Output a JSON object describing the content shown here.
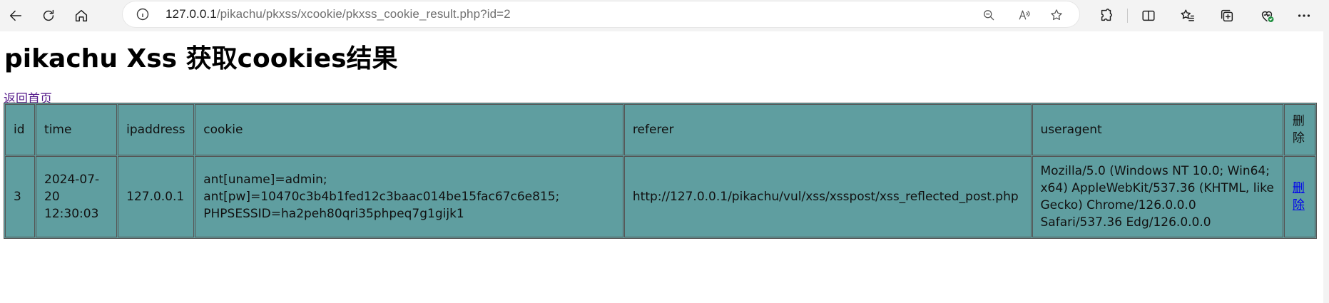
{
  "browser": {
    "url_prefix": "127.0.0.1",
    "url_path": "/pikachu/pkxss/xcookie/pkxss_cookie_result.php?id=2"
  },
  "page": {
    "title": "pikachu Xss 获取cookies结果",
    "back_link": "返回首页"
  },
  "table": {
    "headers": [
      "id",
      "time",
      "ipaddress",
      "cookie",
      "referer",
      "useragent",
      "删除"
    ],
    "rows": [
      {
        "id": "3",
        "time": "2024-07-20 12:30:03",
        "ipaddress": "127.0.0.1",
        "cookie": "ant[uname]=admin; ant[pw]=10470c3b4b1fed12c3baac014be15fac67c6e815; PHPSESSID=ha2peh80qri35phpeq7g1gijk1",
        "referer": "http://127.0.0.1/pikachu/vul/xss/xsspost/xss_reflected_post.php",
        "useragent": "Mozilla/5.0 (Windows NT 10.0; Win64; x64) AppleWebKit/537.36 (KHTML, like Gecko) Chrome/126.0.0.0 Safari/537.36 Edg/126.0.0.0",
        "delete": "删除"
      }
    ]
  },
  "colors": {
    "table_bg": "#5f9ea0",
    "visited_link": "#551a8b",
    "link": "#0000ee"
  },
  "icons": [
    "back-icon",
    "refresh-icon",
    "home-icon",
    "info-icon",
    "zoom-out-icon",
    "read-aloud-icon",
    "favorite-star-icon",
    "extensions-icon",
    "split-screen-icon",
    "favorites-icon",
    "collections-icon",
    "browser-essentials-icon",
    "more-icon"
  ]
}
